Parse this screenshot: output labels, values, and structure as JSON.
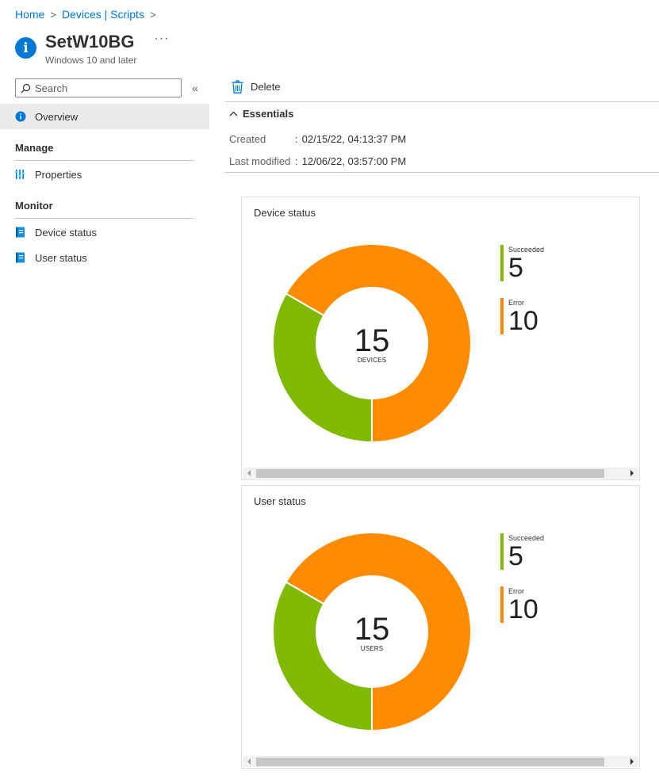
{
  "breadcrumb": {
    "items": [
      "Home",
      "Devices | Scripts"
    ],
    "separator": ">"
  },
  "header": {
    "title": "SetW10BG",
    "more_label": "···",
    "subtitle": "Windows 10 and later",
    "icon": "info-icon"
  },
  "sidebar": {
    "search_placeholder": "Search",
    "collapse_label": "«",
    "overview_label": "Overview",
    "sections": [
      {
        "label": "Manage",
        "items": [
          {
            "label": "Properties",
            "icon": "properties-icon"
          }
        ]
      },
      {
        "label": "Monitor",
        "items": [
          {
            "label": "Device status",
            "icon": "report-icon"
          },
          {
            "label": "User status",
            "icon": "report-icon"
          }
        ]
      }
    ]
  },
  "toolbar": {
    "delete_label": "Delete",
    "icon": "trash-icon"
  },
  "essentials": {
    "label": "Essentials",
    "rows": [
      {
        "key": "Created",
        "sep": ":",
        "value": "02/15/22, 04:13:37 PM"
      },
      {
        "key": "Last modified",
        "sep": ":",
        "value": "12/06/22, 03:57:00 PM"
      }
    ]
  },
  "colors": {
    "succeeded": "#7fba00",
    "error": "#ff8c00",
    "accent": "#0078d4"
  },
  "charts": {
    "device": {
      "title": "Device status",
      "center_value": "15",
      "center_label": "DEVICES",
      "legend": [
        {
          "name": "Succeeded",
          "value": "5"
        },
        {
          "name": "Error",
          "value": "10"
        }
      ]
    },
    "user": {
      "title": "User status",
      "center_value": "15",
      "center_label": "USERS",
      "legend": [
        {
          "name": "Succeeded",
          "value": "5"
        },
        {
          "name": "Error",
          "value": "10"
        }
      ]
    }
  },
  "chart_data": [
    {
      "type": "pie",
      "title": "Device status",
      "categories": [
        "Succeeded",
        "Error"
      ],
      "values": [
        5,
        10
      ],
      "total": 15,
      "center_label": "DEVICES",
      "colors": [
        "#7fba00",
        "#ff8c00"
      ],
      "legend": "right"
    },
    {
      "type": "pie",
      "title": "User status",
      "categories": [
        "Succeeded",
        "Error"
      ],
      "values": [
        5,
        10
      ],
      "total": 15,
      "center_label": "USERS",
      "colors": [
        "#7fba00",
        "#ff8c00"
      ],
      "legend": "right"
    }
  ]
}
